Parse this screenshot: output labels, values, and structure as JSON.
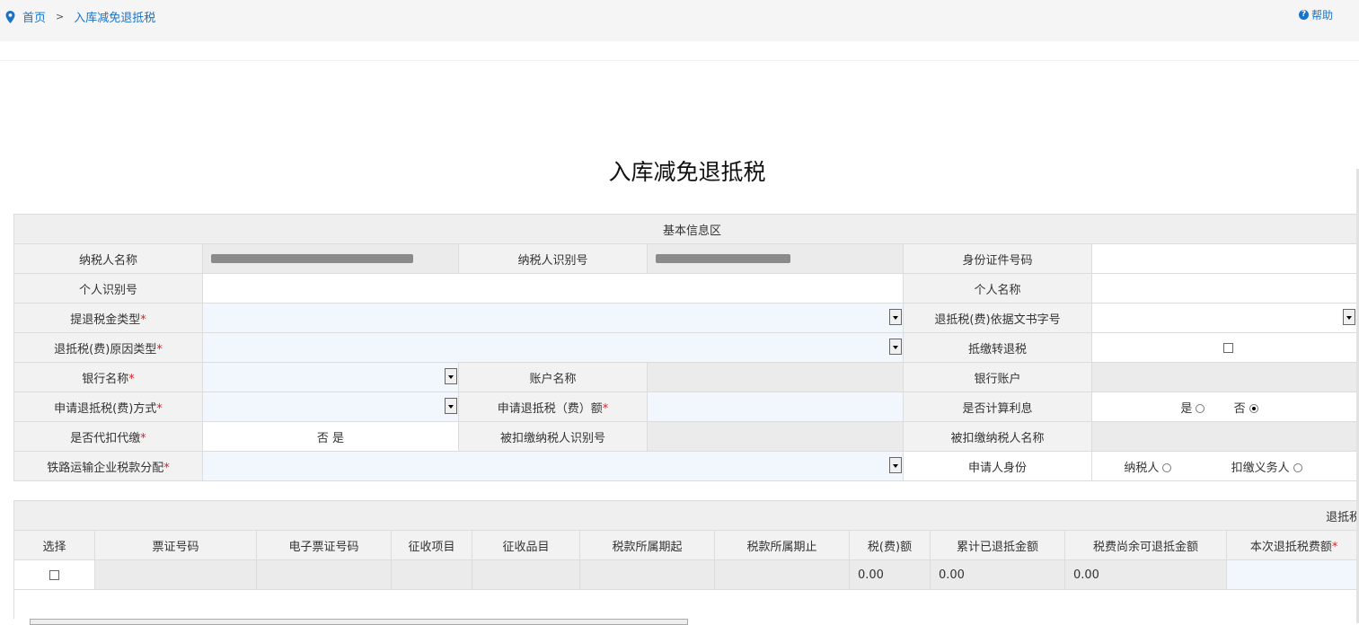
{
  "breadcrumb": {
    "home": "首页",
    "separator": ">",
    "current": "入库减免退抵税"
  },
  "help": {
    "icon": "question-circle-icon",
    "label": "帮助"
  },
  "page_title": "入库减免退抵税",
  "basic_info": {
    "section_title": "基本信息区",
    "taxpayer_name_label": "纳税人名称",
    "taxpayer_name_value": "",
    "taxpayer_id_label": "纳税人识别号",
    "taxpayer_id_value": "",
    "id_doc_label": "身份证件号码",
    "personal_id_label": "个人识别号",
    "personal_name_label": "个人名称",
    "refund_fund_type_label": "提退税金类型",
    "basis_doc_label": "退抵税(费)依据文书字号",
    "reason_type_label": "退抵税(费)原因类型",
    "offset_to_refund_label": "抵缴转退税",
    "bank_name_label": "银行名称",
    "account_name_label": "账户名称",
    "bank_account_label": "银行账户",
    "apply_method_label": "申请退抵税(费)方式",
    "apply_amount_label": "申请退抵税（费）额",
    "calc_interest_label": "是否计算利息",
    "calc_interest_yes": "是",
    "calc_interest_no": "否",
    "calc_interest_selected": "否",
    "withhold_label": "是否代扣代缴",
    "withhold_value": "否 是",
    "withheld_id_label": "被扣缴纳税人识别号",
    "withheld_name_label": "被扣缴纳税人名称",
    "railway_label": "铁路运输企业税款分配",
    "applicant_label": "申请人身份",
    "applicant_opt1": "纳税人",
    "applicant_opt2": "扣缴义务人",
    "required_mark": "*"
  },
  "detail": {
    "section_title": "退抵税",
    "columns": [
      "选择",
      "票证号码",
      "电子票证号码",
      "征收项目",
      "征收品目",
      "税款所属期起",
      "税款所属期止",
      "税(费)额",
      "累计已退抵金额",
      "税费尚余可退抵金额",
      "本次退抵税费额"
    ],
    "rows": [
      {
        "tax_amount": "0.00",
        "refunded_total": "0.00",
        "remaining": "0.00"
      }
    ]
  }
}
